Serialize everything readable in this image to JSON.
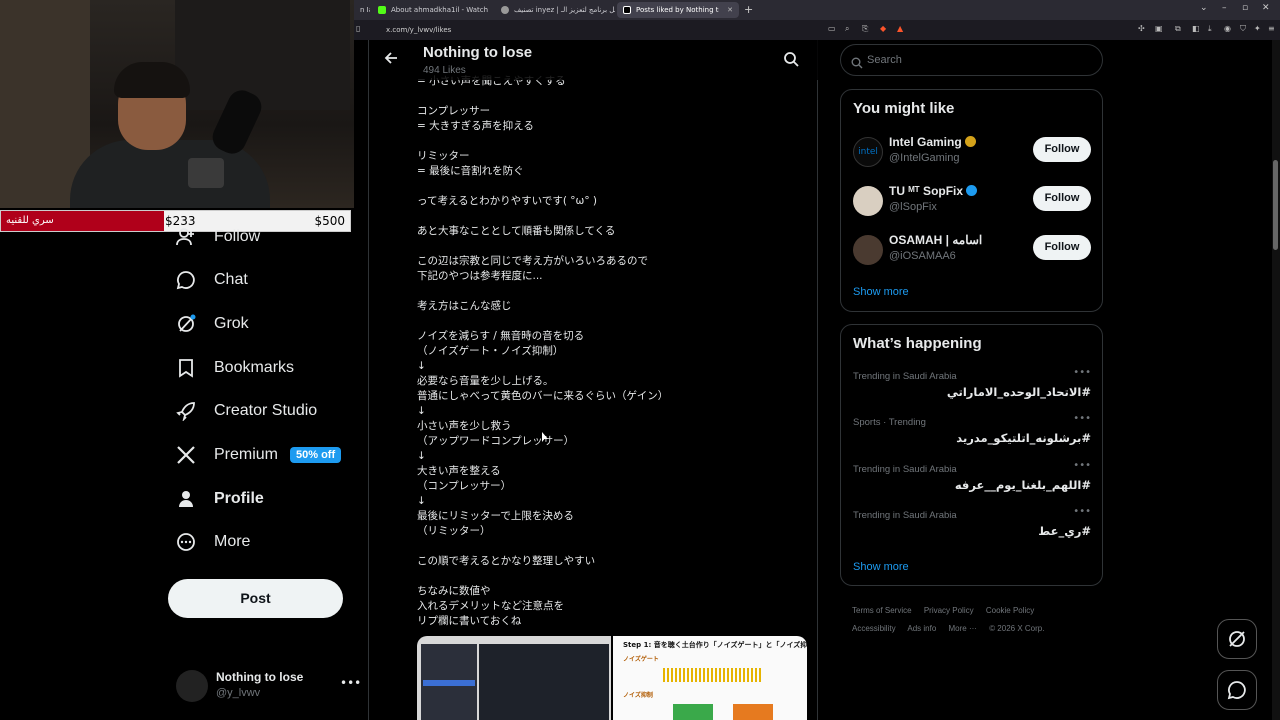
{
  "browser": {
    "tabs": [
      {
        "label": "n Ia"
      },
      {
        "label": "About ahmadkha1il - Watch Live on"
      },
      {
        "label": "تصنيف inyez | أفضل برنامج لتعزيز الـ"
      },
      {
        "label": "Posts liked by Nothing to lose (@"
      }
    ],
    "url": "x.com/y_lvwv/likes"
  },
  "stream": {
    "donation_label": "سري للقنيه",
    "donation_current": "$233",
    "donation_goal": "$500",
    "donation_progress": 0.466
  },
  "sidebar": {
    "items": [
      {
        "label": "Follow",
        "icon": "user-plus-icon"
      },
      {
        "label": "Chat",
        "icon": "chat-bubble-icon"
      },
      {
        "label": "Grok",
        "icon": "grok-icon"
      },
      {
        "label": "Bookmarks",
        "icon": "bookmark-icon"
      },
      {
        "label": "Creator Studio",
        "icon": "rocket-icon"
      },
      {
        "label": "Premium",
        "icon": "x-logo-icon",
        "badge": "50% off"
      },
      {
        "label": "Profile",
        "icon": "person-icon"
      },
      {
        "label": "More",
        "icon": "more-circle-icon"
      }
    ],
    "post_label": "Post",
    "account": {
      "name": "Nothing to lose",
      "handle": "@y_lvwv"
    }
  },
  "main": {
    "title": "Nothing to lose",
    "subtitle": "494 Likes",
    "post_lines": [
      "= 小さい声を聞こえやすくする",
      "",
      "コンプレッサー",
      "= 大きすぎる声を抑える",
      "",
      "リミッター",
      "= 最後に音割れを防ぐ",
      "",
      "って考えるとわかりやすいです( °ω° )",
      "",
      "あと大事なこととして順番も関係してくる",
      "",
      "この辺は宗教と同じで考え方がいろいろあるので",
      "下記のやつは参考程度に...",
      "",
      "考え方はこんな感じ",
      "",
      "ノイズを減らす / 無音時の音を切る",
      "（ノイズゲート・ノイズ抑制）",
      "↓",
      "必要なら音量を少し上げる。",
      "普通にしゃべって黄色のバーに来るぐらい（ゲイン）",
      "↓",
      "小さい声を少し救う",
      "（アップワードコンプレッサー）",
      "↓",
      "大きい声を整える",
      "（コンプレッサー）",
      "↓",
      "最後にリミッターで上限を決める",
      "（リミッター）",
      "",
      "この順で考えるとかなり整理しやすい",
      "",
      "ちなみに数値や",
      "入れるデメリットなど注意点を",
      "リプ欄に書いておくね"
    ],
    "media_step_title": "Step 1: 音を聴く土台作り「ノイズゲート」と「ノイズ抑制」",
    "media_noise_gate": "ノイズゲート",
    "media_noise_suppress": "ノイズ抑制"
  },
  "right": {
    "search_placeholder": "Search",
    "you_might_like_title": "You might like",
    "suggestions": [
      {
        "name": "Intel Gaming",
        "handle": "@IntelGaming",
        "follow": "Follow"
      },
      {
        "name": "TU ᴹᵀ SopFix",
        "handle": "@lSopFix",
        "follow": "Follow"
      },
      {
        "name": "OSAMAH | اسامه",
        "handle": "@iOSAMAA6",
        "follow": "Follow"
      }
    ],
    "show_more": "Show more",
    "whats_happening_title": "What’s happening",
    "trends": [
      {
        "context": "Trending in Saudi Arabia",
        "topic": "#الاتحاد_الوحده_الاماراتي"
      },
      {
        "context": "Sports · Trending",
        "topic": "#برشلونه_اتلتيكو_مدريد"
      },
      {
        "context": "Trending in Saudi Arabia",
        "topic": "#اللهم_بلغنا_يوم__عرفه"
      },
      {
        "context": "Trending in Saudi Arabia",
        "topic": "#ري_عط"
      }
    ],
    "trends_show_more": "Show more",
    "footer": [
      "Terms of Service",
      "Privacy Policy",
      "Cookie Policy",
      "Accessibility",
      "Ads info",
      "More ···",
      "© 2026 X Corp."
    ]
  }
}
